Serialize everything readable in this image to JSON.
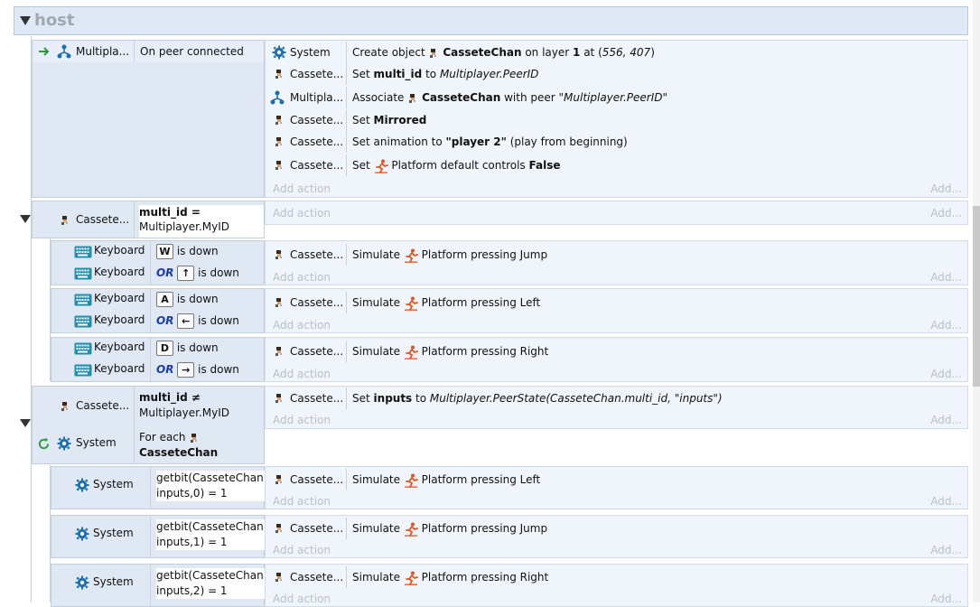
{
  "group": {
    "title": "host"
  },
  "add_action": "Add action",
  "add_more": "Add...",
  "events": {
    "e1": {
      "cond_obj": "Multipla...",
      "cond_text": "On peer connected",
      "actions": [
        {
          "obj": "System",
          "pre": "Create object ",
          "bold1": "CasseteChan",
          "mid": " on layer ",
          "bold2": "1",
          "mid2": " at (",
          "ital": "556, 407",
          "post": ")"
        },
        {
          "obj": "Cassete...",
          "pre": "Set ",
          "bold1": "multi_id",
          "mid": " to ",
          "ital": "Multiplayer.PeerID"
        },
        {
          "obj": "Multipla...",
          "pre": "Associate ",
          "bold1": "CasseteChan",
          "mid": " with peer \"",
          "ital": "Multiplayer.PeerID",
          "post": "\""
        },
        {
          "obj": "Cassete...",
          "pre": "Set ",
          "bold1": "Mirrored"
        },
        {
          "obj": "Cassete...",
          "pre": "Set animation to ",
          "bold1": "\"player 2\"",
          "post": " (play from beginning)"
        },
        {
          "obj": "Cassete...",
          "pre": "Set ",
          "plat": "Platform default controls ",
          "bold1": "False"
        }
      ]
    },
    "e2": {
      "cond_obj": "Cassete...",
      "cond_line1": "multi_id =",
      "cond_line2": "Multiplayer.MyID"
    },
    "k1": {
      "obj": "Keyboard",
      "key": "W",
      "suffix": "is down",
      "or": "OR",
      "key2": "↑",
      "suffix2": "is down",
      "act_obj": "Cassete...",
      "act_pre": "Simulate ",
      "act_plat": "Platform pressing Jump"
    },
    "k2": {
      "obj": "Keyboard",
      "key": "A",
      "suffix": "is down",
      "or": "OR",
      "key2": "←",
      "suffix2": "is down",
      "act_obj": "Cassete...",
      "act_pre": "Simulate ",
      "act_plat": "Platform pressing Left"
    },
    "k3": {
      "obj": "Keyboard",
      "key": "D",
      "suffix": "is down",
      "or": "OR",
      "key2": "→",
      "suffix2": "is down",
      "act_obj": "Cassete...",
      "act_pre": "Simulate ",
      "act_plat": "Platform pressing Right"
    },
    "e3": {
      "cond_obj": "Cassete...",
      "cond_line1": "multi_id ≠",
      "cond_line2": "Multiplayer.MyID",
      "sys_obj": "System",
      "foreach": "For each ",
      "foreach_obj": "CasseteChan",
      "act_obj": "Cassete...",
      "act_pre": "Set ",
      "act_bold": "inputs",
      "act_mid": " to ",
      "act_ital": "Multiplayer.PeerState(CasseteChan.multi_id, \"inputs\")"
    },
    "s1": {
      "obj": "System",
      "line1": "getbit(CasseteChan.",
      "line2": "inputs,0) = 1",
      "act_obj": "Cassete...",
      "act_pre": "Simulate ",
      "act_plat": "Platform pressing Left"
    },
    "s2": {
      "obj": "System",
      "line1": "getbit(CasseteChan.",
      "line2": "inputs,1) = 1",
      "act_obj": "Cassete...",
      "act_pre": "Simulate ",
      "act_plat": "Platform pressing Jump"
    },
    "s3": {
      "obj": "System",
      "line1": "getbit(CasseteChan.",
      "line2": "inputs,2) = 1",
      "act_obj": "Cassete...",
      "act_pre": "Simulate ",
      "act_plat": "Platform pressing Right"
    }
  },
  "colors": {
    "accent_green": "#2a9a3c",
    "platform_orange": "#e0531f",
    "or_blue": "#1a3fa8",
    "keyboard_teal": "#1f8fb0",
    "gear_blue": "#1c6fb0"
  },
  "icons": {
    "trigger": "arrow-right-icon",
    "multiplayer": "network-icon",
    "system": "gear-icon",
    "object": "character-sprite-icon",
    "keyboard": "keyboard-icon",
    "platform": "running-man-icon",
    "loop": "loop-icon"
  }
}
